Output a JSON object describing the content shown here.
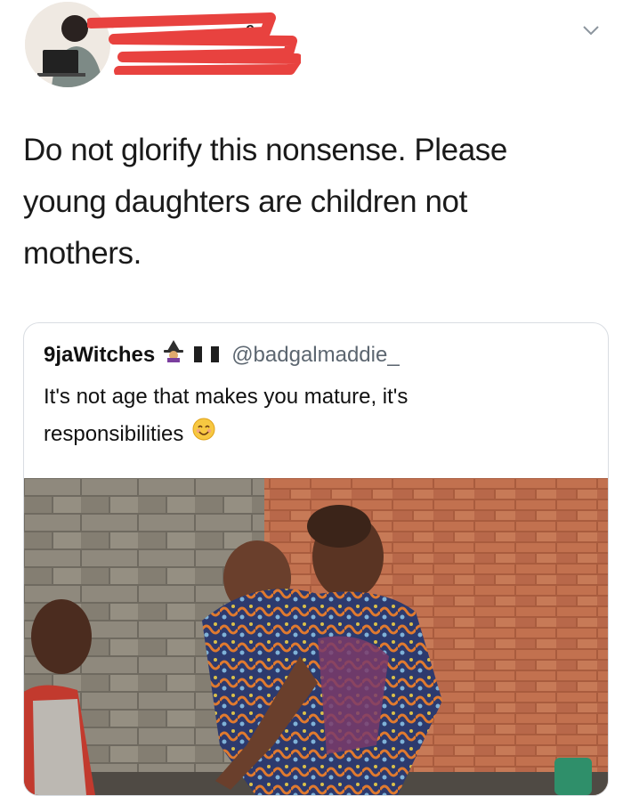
{
  "tweet": {
    "user_name_visible": "e",
    "text_lines": [
      "Do not glorify this nonsense. Please",
      "young daughters are children not",
      "mothers."
    ]
  },
  "quoted_tweet": {
    "name": "9jaWitches",
    "name_emojis": [
      "witch-emoji",
      "nigeria-flag-emoji"
    ],
    "handle": "@badgalmaddie_",
    "text_lines": [
      "It's not age that makes you mature, it's",
      "responsibilities"
    ],
    "trailing_emoji": "smiling-face-emoji"
  },
  "colors": {
    "redaction": "#e8423f",
    "quote_border": "#d9dde2",
    "brick": "#b8684a",
    "wall_gray": "#8a8478"
  }
}
